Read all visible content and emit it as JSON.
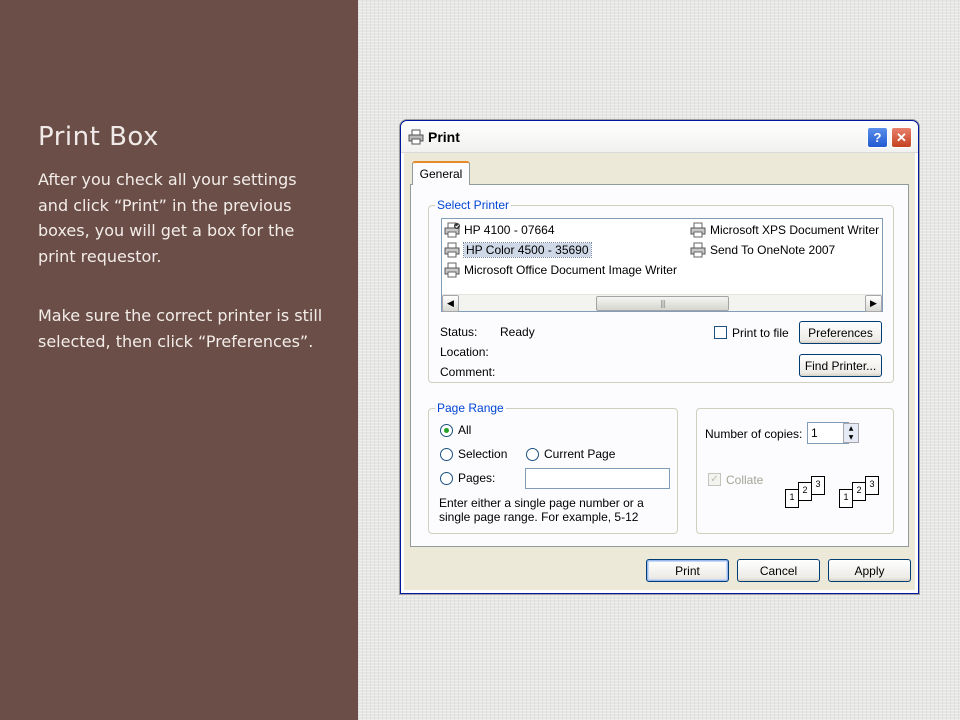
{
  "slide": {
    "title": "Print Box",
    "paragraph1": "After you check all your settings and click “Print” in the previous boxes, you will get a box for the print requestor.",
    "paragraph2": "Make sure the correct printer is still selected, then click “Preferences”.",
    "left_color": "#6b4e48"
  },
  "dialog": {
    "title": "Print",
    "help_glyph": "?",
    "close_glyph": "✕",
    "tab_label": "General",
    "select_printer": {
      "label": "Select Printer",
      "printers_col1": [
        {
          "name": "HP 4100 - 07664",
          "icon": "printer-default-icon",
          "selected": false
        },
        {
          "name": "HP Color 4500 - 35690",
          "icon": "printer-icon",
          "selected": true
        },
        {
          "name": "Microsoft Office Document Image Writer",
          "icon": "printer-icon",
          "selected": false
        }
      ],
      "printers_col2": [
        {
          "name": "Microsoft XPS Document Writer",
          "icon": "printer-icon",
          "selected": false
        },
        {
          "name": "Send To OneNote 2007",
          "icon": "printer-icon",
          "selected": false
        }
      ],
      "scroll_left": "◀",
      "scroll_right": "▶",
      "scroll_grip": "|||",
      "status_label": "Status:",
      "status_value": "Ready",
      "location_label": "Location:",
      "comment_label": "Comment:",
      "print_to_file_label": "Print to file",
      "preferences_button": "Preferences",
      "find_printer_button": "Find Printer..."
    },
    "page_range": {
      "label": "Page Range",
      "options": [
        "All",
        "Selection",
        "Current Page",
        "Pages:"
      ],
      "selected": "All",
      "pages_value": "",
      "hint": "Enter either a single page number or a single page range.  For example, 5-12"
    },
    "copies": {
      "label": "Number of copies:",
      "value": "1",
      "collate_label": "Collate",
      "collate_checked": true,
      "collate_pages_a": [
        "1",
        "2",
        "3"
      ],
      "collate_pages_b": [
        "1",
        "2",
        "3"
      ]
    },
    "buttons": {
      "print": "Print",
      "cancel": "Cancel",
      "apply": "Apply"
    }
  }
}
